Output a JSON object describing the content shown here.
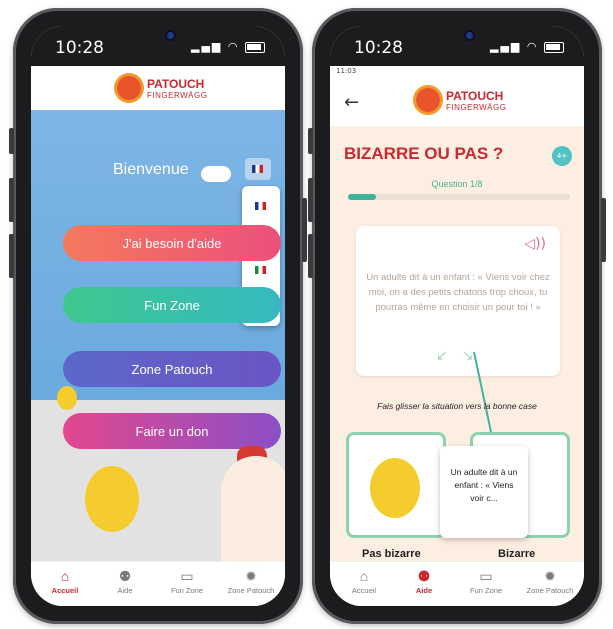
{
  "left_phone": {
    "status": {
      "time": "10:28"
    },
    "brand": {
      "line1": "PATOUCH",
      "line2": "FINGERWÄGG"
    },
    "welcome": "Bienvenue",
    "buttons": [
      "J'ai besoin d'aide",
      "Fun Zone",
      "Zone Patouch",
      "Faire un don"
    ],
    "tabs": [
      {
        "label": "Accueil",
        "icon": "home-icon",
        "active": true
      },
      {
        "label": "Aide",
        "icon": "family-icon",
        "active": false
      },
      {
        "label": "Fun Zone",
        "icon": "gamepad-icon",
        "active": false
      },
      {
        "label": "Zone Patouch",
        "icon": "badge-icon",
        "active": false
      }
    ]
  },
  "right_phone": {
    "status": {
      "time": "10:28"
    },
    "inner_status": "11:03",
    "brand": {
      "line1": "PATOUCH",
      "line2": "FINGERWÄGG"
    },
    "title": "BIZARRE OU PAS ?",
    "age_badge": "4+",
    "question_label": "Question 1/8",
    "progress_fraction": 0.125,
    "card_text": "Un adulte dit à un enfant : « Viens voir chez moi, on a des petits chatons trop choux, tu pourras même en choisir un pour toi ! »",
    "instruction": "Fais glisser la situation vers la bonne case",
    "drag_card_text": "Un adulte dit à un enfant : « Viens voir c...",
    "left_box_label": "Pas bizarre",
    "right_box_label": "Bizarre",
    "tabs": [
      {
        "label": "Accueil",
        "icon": "home-icon",
        "active": false
      },
      {
        "label": "Aide",
        "icon": "family-icon",
        "active": true
      },
      {
        "label": "Fun Zone",
        "icon": "gamepad-icon",
        "active": false
      },
      {
        "label": "Zone Patouch",
        "icon": "badge-icon",
        "active": false
      }
    ]
  },
  "colors": {
    "brand_red": "#c8292f",
    "teal": "#3fb49c"
  }
}
